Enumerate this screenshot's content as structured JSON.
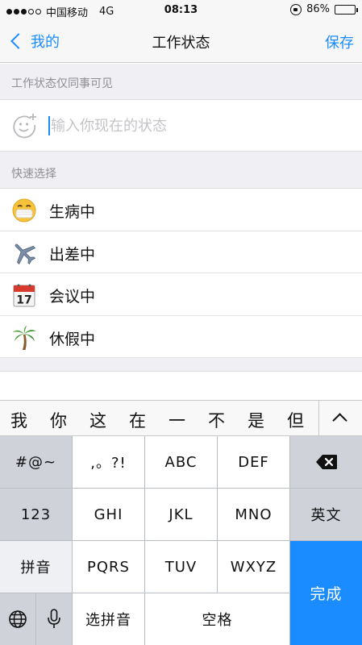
{
  "status_bar": {
    "carrier": "中国移动",
    "network": "4G",
    "time": "08:13",
    "battery": "86%",
    "battery_level": 0.86
  },
  "nav": {
    "back_label": "我的",
    "title": "工作状态",
    "save_label": "保存"
  },
  "visibility_note": "工作状态仅同事可见",
  "status_input": {
    "placeholder": "输入你现在的状态",
    "value": ""
  },
  "quick_select": {
    "header": "快速选择",
    "items": [
      {
        "label": "生病中",
        "icon": "mask-face-icon"
      },
      {
        "label": "出差中",
        "icon": "airplane-icon"
      },
      {
        "label": "会议中",
        "icon": "calendar-icon",
        "icon_text": "17"
      },
      {
        "label": "休假中",
        "icon": "palm-tree-icon"
      }
    ]
  },
  "keyboard": {
    "candidates": [
      "我",
      "你",
      "这",
      "在",
      "一",
      "不",
      "是",
      "但"
    ],
    "rows": [
      [
        "#@~",
        ",。?!",
        "ABC",
        "DEF",
        "delete-icon"
      ],
      [
        "123",
        "GHI",
        "JKL",
        "MNO",
        "英文"
      ],
      [
        "拼音",
        "PQRS",
        "TUV",
        "WXYZ"
      ],
      [
        "globe-icon",
        "mic-icon",
        "选拼音",
        "空格"
      ]
    ],
    "done_label": "完成",
    "colors": {
      "done": "#1a8cff",
      "function_key": "#cfd2d9"
    }
  }
}
